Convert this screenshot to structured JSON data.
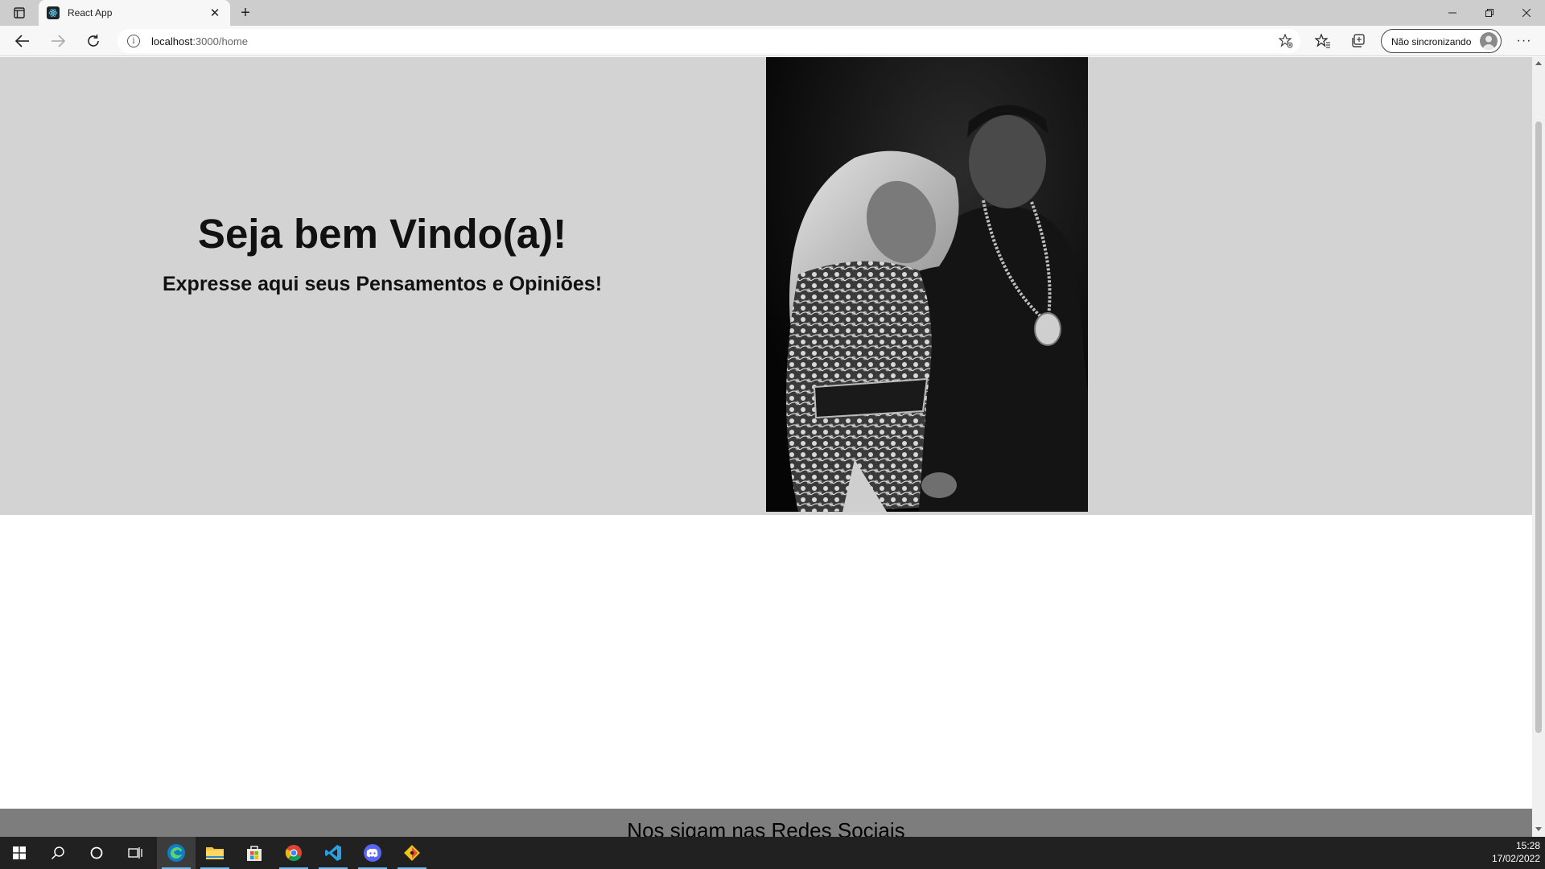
{
  "browser": {
    "tab_title": "React App",
    "url_host": "localhost",
    "url_path": ":3000/home",
    "profile_label": "Não sincronizando",
    "more_label": "···"
  },
  "page": {
    "welcome_heading": "Seja bem Vindo(a)!",
    "subtitle": "Expresse aqui seus Pensamentos e Opiniões!",
    "footer_text": "Nos sigam nas Redes Sociais"
  },
  "taskbar": {
    "time": "15:28",
    "date": "17/02/2022",
    "apps": [
      "start-icon",
      "search-icon",
      "cortana-icon",
      "task-view-icon",
      "edge-icon",
      "file-explorer-icon",
      "store-icon",
      "chrome-icon",
      "vscode-icon",
      "discord-icon",
      "git-icon"
    ]
  },
  "colors": {
    "hero_bg": "#d3d3d3",
    "footer_bg": "#7d7d7d",
    "taskbar_bg": "#212121",
    "accent": "#76b9ed"
  }
}
